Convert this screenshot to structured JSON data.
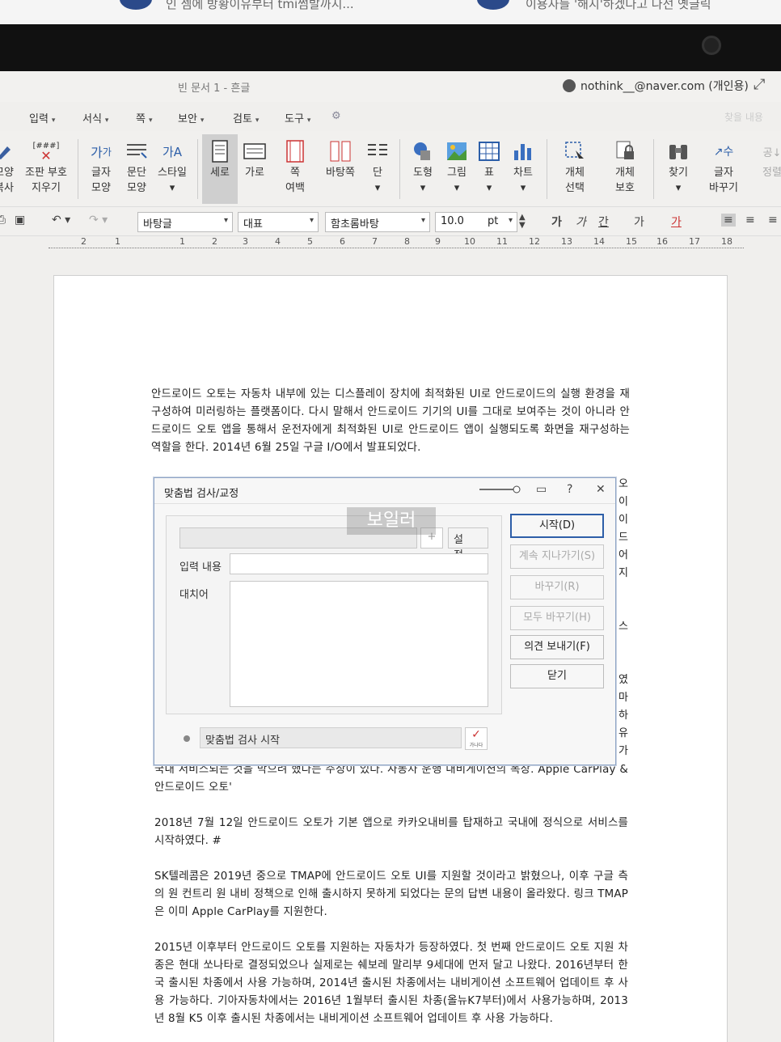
{
  "notification": {
    "left_text": "인 셈에 방황이유부터 tmi썸발까지...",
    "right_text": "이용자들 '해지'하겠다고 나선 옛글릭"
  },
  "window": {
    "doc_title": "빈 문서 1 - 흔글",
    "user": "nothink__@naver.com (개인용)",
    "search_hint": "찾을 내용"
  },
  "menu": [
    "입력",
    "서식",
    "쪽",
    "보안",
    "검토",
    "도구"
  ],
  "ribbon": {
    "buttons": [
      {
        "label": "모양\n복사"
      },
      {
        "label": "조판 부호\n지우기"
      },
      {
        "label": "글자\n모양"
      },
      {
        "label": "문단\n모양"
      },
      {
        "label": "스타일"
      },
      {
        "label": "세로"
      },
      {
        "label": "가로"
      },
      {
        "label": "쪽\n여백"
      },
      {
        "label": "바탕쪽"
      },
      {
        "label": "단"
      },
      {
        "label": "도형"
      },
      {
        "label": "그림"
      },
      {
        "label": "표"
      },
      {
        "label": "차트"
      },
      {
        "label": "개체\n선택"
      },
      {
        "label": "개체\n보호"
      },
      {
        "label": "찾기"
      },
      {
        "label": "글자\n바꾸기"
      },
      {
        "label": "정렬"
      }
    ],
    "clear_code_icon_text": "[###]"
  },
  "toolbar": {
    "style": "바탕글",
    "lang": "대표",
    "font": "함초롬바탕",
    "size": "10.0",
    "unit": "pt",
    "font_btns": [
      "가",
      "가",
      "간",
      "가",
      "가"
    ]
  },
  "ruler": [
    "2",
    "1",
    "1",
    "2",
    "3",
    "4",
    "5",
    "6",
    "7",
    "8",
    "9",
    "10",
    "11",
    "12",
    "13",
    "14",
    "15",
    "16",
    "17",
    "18"
  ],
  "document": {
    "p1": "안드로이드 오토는 자동차 내부에 있는 디스플레이 장치에 최적화된 UI로 안드로이드의 실행 환경을 재구성하여 미러링하는 플랫폼이다. 다시 말해서 안드로이드 기기의 UI를 그대로 보여주는 것이 아니라 안드로이드 오토 앱을 통해서 운전자에게 최적화된 UI로 안드로이드 앱이 실행되도록 화면을 재구성하는 역할을 한다. 2014년 6월 25일 구글 I/O에서 발표되었다.",
    "side_chars": [
      "오",
      "이",
      "이",
      "드",
      "어",
      "지",
      "",
      "스",
      "",
      "",
      "였",
      "마",
      "하",
      "유",
      "가"
    ],
    "p2_partial": "국내 서비스되는 것을 막으려 했다는 주장이 있다. 자동차 운행 내비게이션의 폭장. Apple CarPlay & 안드로이드 오토'",
    "p3": "2018년 7월 12일 안드로이드 오토가 기본 앱으로 카카오내비를 탑재하고 국내에 정식으로 서비스를 시작하였다. #",
    "p4": "SK텔레콤은 2019년 중으로 TMAP에 안드로이드 오토 UI를 지원할 것이라고 밝혔으나, 이후 구글 측의 원 컨트리 원 내비 정책으로 인해 출시하지 못하게 되었다는 문의 답변 내용이 올라왔다. 링크 TMAP은 이미 Apple CarPlay를 지원한다.",
    "p5": "2015년 이후부터 안드로이드 오토를 지원하는 자동차가 등장하였다. 첫 번째 안드로이드 오토 지원 차종은 현대 쏘나타로 결정되었으나 실제로는 쉐보레 말리부 9세대에 먼저 달고 나왔다. 2016년부터 한국 출시된 차종에서 사용 가능하며, 2014년 출시된 차종에서는 내비게이션 소프트웨어 업데이트 후 사용 가능하다. 기아자동차에서는 2016년 1월부터 출시된 차종(올뉴K7부터)에서 사용가능하며, 2013년 8월 K5 이후 출시된 차종에서는 내비게이션 소프트웨어 업데이트 후 사용 가능하다."
  },
  "dialog": {
    "title": "맞춤법 검사/교정",
    "help": "?",
    "close": "✕",
    "watermark": "보일러",
    "settings_btn": "설정...",
    "plus": "+",
    "input_label": "입력 내용",
    "replace_label": "대치어",
    "status": "맞춤법 검사 시작",
    "check_caption": "가나다",
    "buttons": [
      {
        "label": "시작(D)",
        "state": "primary"
      },
      {
        "label": "계속 지나가기(S)",
        "state": "disabled"
      },
      {
        "label": "바꾸기(R)",
        "state": "disabled"
      },
      {
        "label": "모두 바꾸기(H)",
        "state": "disabled"
      },
      {
        "label": "의견 보내기(F)",
        "state": "enabled"
      },
      {
        "label": "닫기",
        "state": "enabled"
      }
    ]
  }
}
